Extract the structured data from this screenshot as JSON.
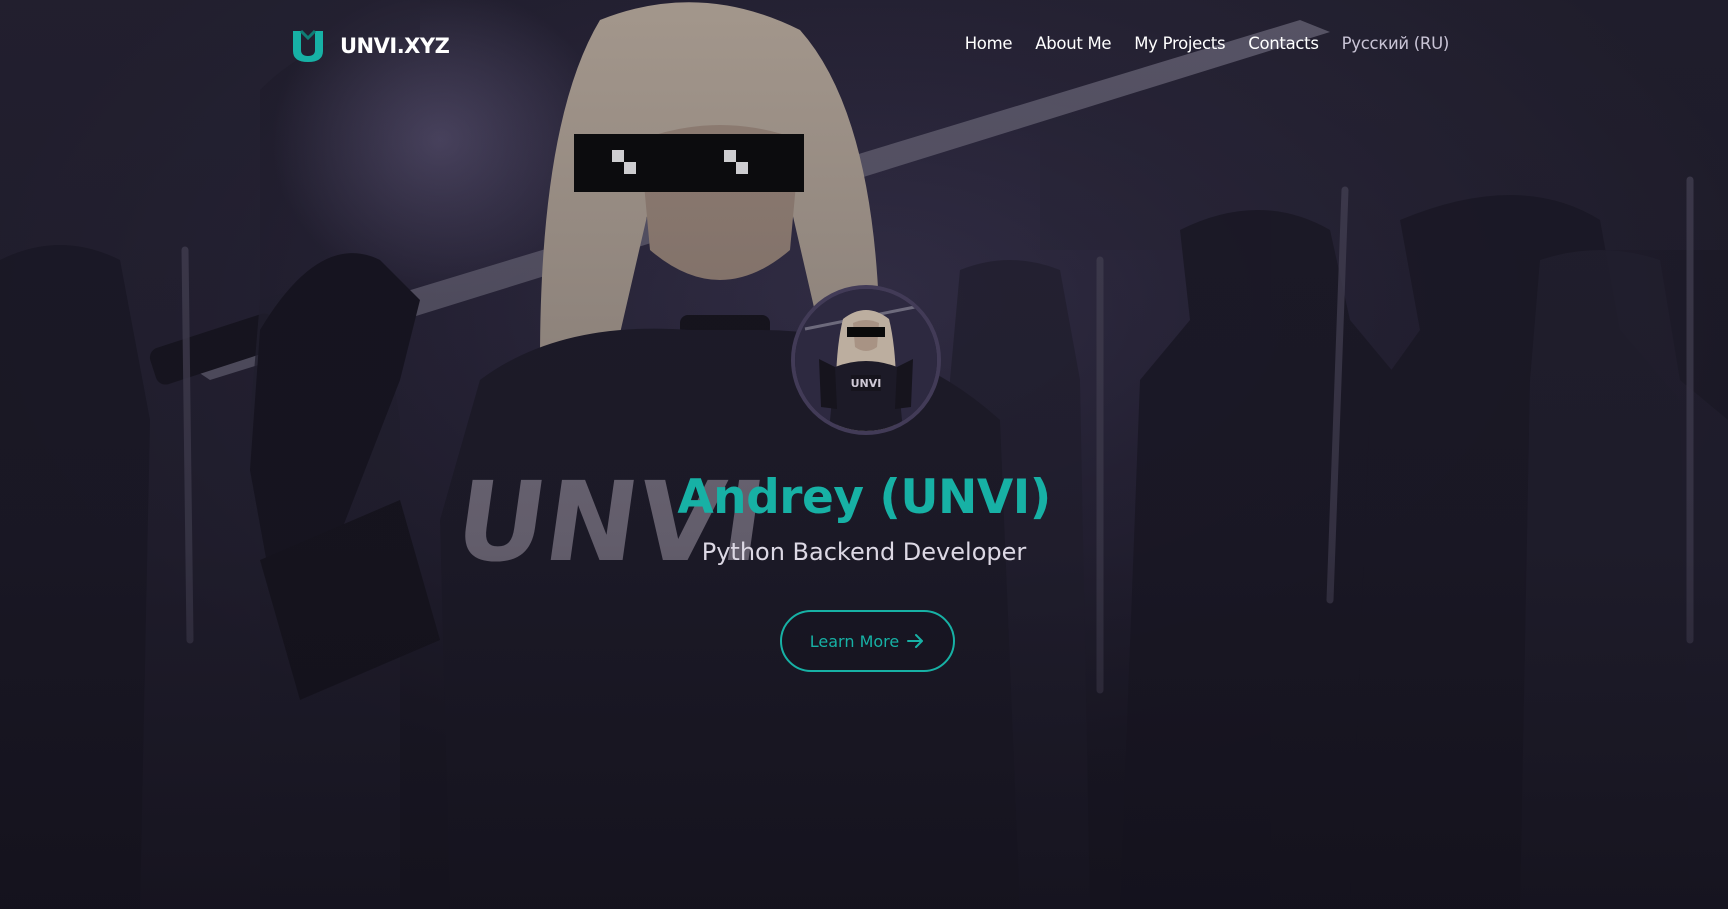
{
  "brand": {
    "name": "UNVI.XYZ",
    "logo_icon": "unvi-logo-icon",
    "accent_color": "#17b1a5"
  },
  "nav": {
    "items": [
      {
        "label": "Home"
      },
      {
        "label": "About Me"
      },
      {
        "label": "My Projects"
      },
      {
        "label": "Contacts"
      },
      {
        "label": "Русский (RU)"
      }
    ]
  },
  "hero": {
    "avatar_icon": "anime-avatar",
    "title": "Andrey (UNVI)",
    "subtitle": "Python Backend Developer",
    "cta_label": "Learn More",
    "cta_icon": "arrow-right-icon",
    "background": "anime-samurai-illustration",
    "shirt_text": "UNVI"
  }
}
